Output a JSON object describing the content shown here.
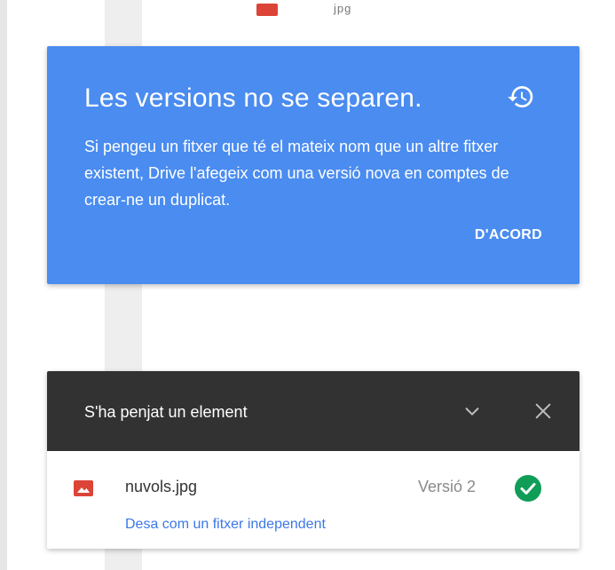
{
  "background": {
    "file_name_partial": "jpg"
  },
  "promo": {
    "title": "Les versions no se separen.",
    "body": "Si pengeu un fitxer que té el mateix nom que un altre fitxer existent, Drive l'afegeix com una versió nova en comptes de crear-ne un duplicat.",
    "ok_label": "D'ACORD",
    "icon": "history-icon",
    "color": "#4a8cf0"
  },
  "upload_panel": {
    "title": "S'ha penjat un element",
    "collapse_icon": "chevron-down-icon",
    "close_icon": "close-icon",
    "header_color": "#323232",
    "item": {
      "file_name": "nuvols.jpg",
      "version": "Versió 2",
      "file_icon": "image-file-icon",
      "status_icon": "check-circle-icon",
      "status_color": "#0f9d58",
      "link_label": "Desa com un fitxer independent"
    }
  }
}
